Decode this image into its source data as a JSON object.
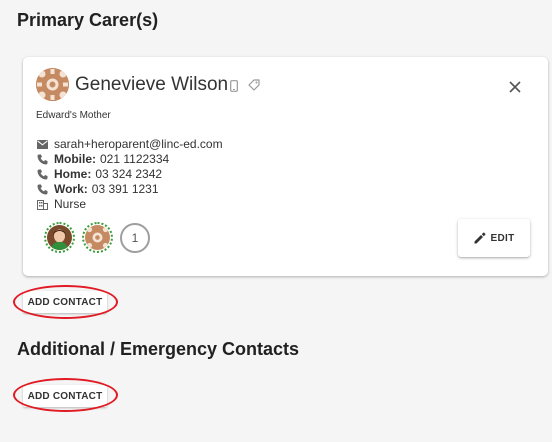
{
  "sections": {
    "primary_title": "Primary Carer(s)",
    "additional_title": "Additional / Emergency Contacts"
  },
  "contact": {
    "name": "Genevieve Wilson",
    "relation": "Edward's Mother",
    "email": "sarah+heroparent@linc-ed.com",
    "mobile_label": "Mobile:",
    "mobile": "021 1122334",
    "home_label": "Home:",
    "home": "03 324 2342",
    "work_label": "Work:",
    "work": "03 391 1231",
    "occupation": "Nurse",
    "extra_count": "1",
    "edit_label": "EDIT"
  },
  "buttons": {
    "add_contact_primary": "ADD CONTACT",
    "add_contact_additional": "ADD CONTACT"
  },
  "icons": {
    "email": "email-icon",
    "phone": "phone-icon",
    "work": "building-icon",
    "mobile": "mobile-phone-icon",
    "tag": "tag-icon",
    "close": "close-icon",
    "edit": "pencil-icon"
  },
  "colors": {
    "highlight": "#e01b24",
    "chip_border": "#3b9e3b",
    "avatar": "#c68a63"
  }
}
